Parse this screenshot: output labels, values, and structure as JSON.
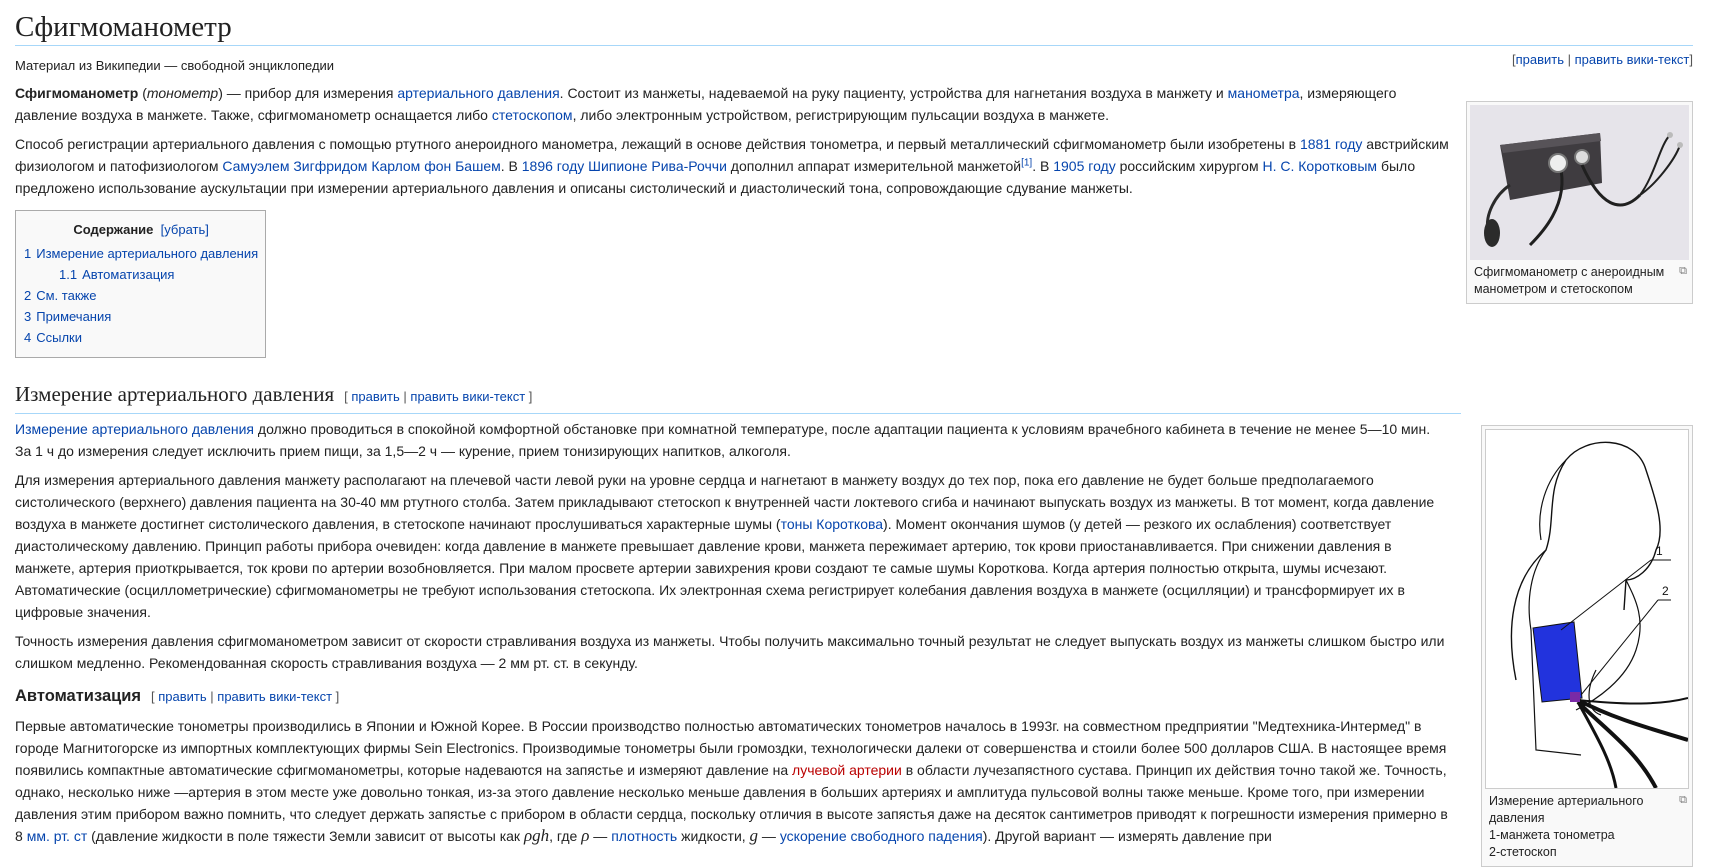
{
  "title": "Сфигмоманометр",
  "site_sub": "Материал из Википедии — свободной энциклопедии",
  "edit": {
    "open": "[",
    "edit": "править",
    "sep": " | ",
    "edit_wiki": "править вики-текст",
    "close": "]",
    "open_sp": "[ ",
    "close_sp": " ]"
  },
  "intro": {
    "p1": {
      "bold": "Сфигмоманометр",
      "t1": " (",
      "italic": "тонометр",
      "t2": ") — прибор для измерения ",
      "l1": "артериального давления",
      "t3": ". Состоит из манжеты, надеваемой на руку пациенту, устройства для нагнетания воздуха в манжету и ",
      "l2": "манометра",
      "t4": ", измеряющего давление воздуха в манжете. Также, сфигмоманометр оснащается либо ",
      "l3": "стетоскопом",
      "t5": ", либо электронным устройством, регистрирующим пульсации воздуха в манжете."
    },
    "p2": {
      "t1": "Способ регистрации артериального давления с помощью ртутного анероидного манометра, лежащий в основе действия тонометра, и первый металлический сфигмоманометр были изобретены в ",
      "l1": "1881 году",
      "t2": " австрийским физиологом и патофизиологом ",
      "l2": "Самуэлем Зигфридом Карлом фон Башем",
      "t3": ". В ",
      "l3": "1896 году",
      "t4": " ",
      "l4": "Шипионе Рива-Роччи",
      "t5": " дополнил аппарат измерительной манжетой",
      "ref": "[1]",
      "t6": ". В ",
      "l5": "1905 году",
      "t7": " российским хирургом ",
      "l6": "Н. С. Коротковым",
      "t8": " было предложено использование аускультации при измерении артериального давления и описаны систолический и диастолический тона, сопровождающие сдувание манжеты."
    }
  },
  "toc": {
    "title": "Содержание",
    "toggle": "[убрать]",
    "items": [
      {
        "num": "1",
        "label": "Измерение артериального давления"
      },
      {
        "num": "1.1",
        "label": "Автоматизация"
      },
      {
        "num": "2",
        "label": "См. также"
      },
      {
        "num": "3",
        "label": "Примечания"
      },
      {
        "num": "4",
        "label": "Ссылки"
      }
    ]
  },
  "section1": {
    "heading": "Измерение артериального давления",
    "p1": {
      "l1": "Измерение артериального давления",
      "t1": " должно проводиться в спокойной комфортной обстановке при комнатной температуре, после адаптации пациента к условиям врачебного кабинета в течение не менее 5—10 мин. За 1 ч до измерения следует исключить прием пищи, за 1,5—2 ч — курение, прием тонизирующих напитков, алкоголя."
    },
    "p2": {
      "t1": "Для измерения артериального давления манжету располагают на плечевой части левой руки на уровне сердца и нагнетают в манжету воздух до тех пор, пока его давление не будет больше предполагаемого систолического (верхнего) давления пациента на 30-40 мм ртутного столба. Затем прикладывают стетоскоп к внутренней части локтевого сгиба и начинают выпускать воздух из манжеты. В тот момент, когда давление воздуха в манжете достигнет систолического давления, в стетоскопе начинают прослушиваться характерные шумы (",
      "l1": "тоны Короткова",
      "t2": "). Момент окончания шумов (у детей — резкого их ослабления) соответствует диастолическому давлению. Принцип работы прибора очевиден: когда давление в манжете превышает давление крови, манжета пережимает артерию, ток крови приостанавливается. При снижении давления в манжете, артерия приоткрывается, ток крови по артерии возобновляется. При малом просвете артерии завихрения крови создают те самые шумы Короткова. Когда артерия полностью открыта, шумы исчезают. Автоматические (осциллометрические) сфигмоманометры не требуют использования стетоскопа. Их электронная схема регистрирует колебания давления воздуха в манжете (осцилляции) и трансформирует их в цифровые значения."
    },
    "p3": "Точность измерения давления сфигмоманометром зависит от скорости стравливания воздуха из манжеты. Чтобы получить максимально точный результат не следует выпускать воздух из манжеты слишком быстро или слишком медленно. Рекомендованная скорость стравливания воздуха — 2 мм рт. ст. в секунду."
  },
  "section2": {
    "heading": "Автоматизация",
    "p1": {
      "t1": "Первые автоматические тонометры производились в Японии и Южной Корее. В России производство полностью автоматических тонометров началось в 1993г. на совместном предприятии \"Медтехника-Интермед\" в городе Магнитогорске из импортных комплектующих фирмы Sein Electronics. Производимые тонометры были громоздки, технологически далеки от совершенства и стоили более 500 долларов США. В настоящее время появились компактные автоматические сфигмоманометры, которые надеваются на запястье и измеряют давление на ",
      "l1": "лучевой артерии",
      "t2": " в области лучезапястного сустава. Принцип их действия точно такой же. Точность, однако, несколько ниже —артерия в этом месте уже довольно тонкая, из-за этого давление несколько меньше давления в больших артериях и амплитуда пульсовой волны также меньше. Кроме того, при измерении давления этим прибором важно помнить, что следует держать запястье с прибором в области сердца, поскольку отличия в высоте запястья даже на десяток сантиметров приводят к погрешности измерения примерно в 8 ",
      "l2": "мм. рт. ст",
      "t3": " (давление жидкости в поле тяжести Земли зависит от высоты как ",
      "m1": "ρgh",
      "t4": ", где ",
      "m2": "ρ",
      "t5": " — ",
      "l3": "плотность",
      "t6": " жидкости, ",
      "m3": "g",
      "t7": " — ",
      "l4": "ускорение свободного падения",
      "t8": "). Другой вариант — измерять давление при"
    }
  },
  "figure1": {
    "caption": "Сфигмоманометр с анероидным манометром и стетоскопом"
  },
  "figure2": {
    "label1": "1",
    "label2": "2",
    "cap1": "Измерение артериального давления",
    "cap2": "1-манжета тонометра",
    "cap3": "2-стетоскоп"
  }
}
